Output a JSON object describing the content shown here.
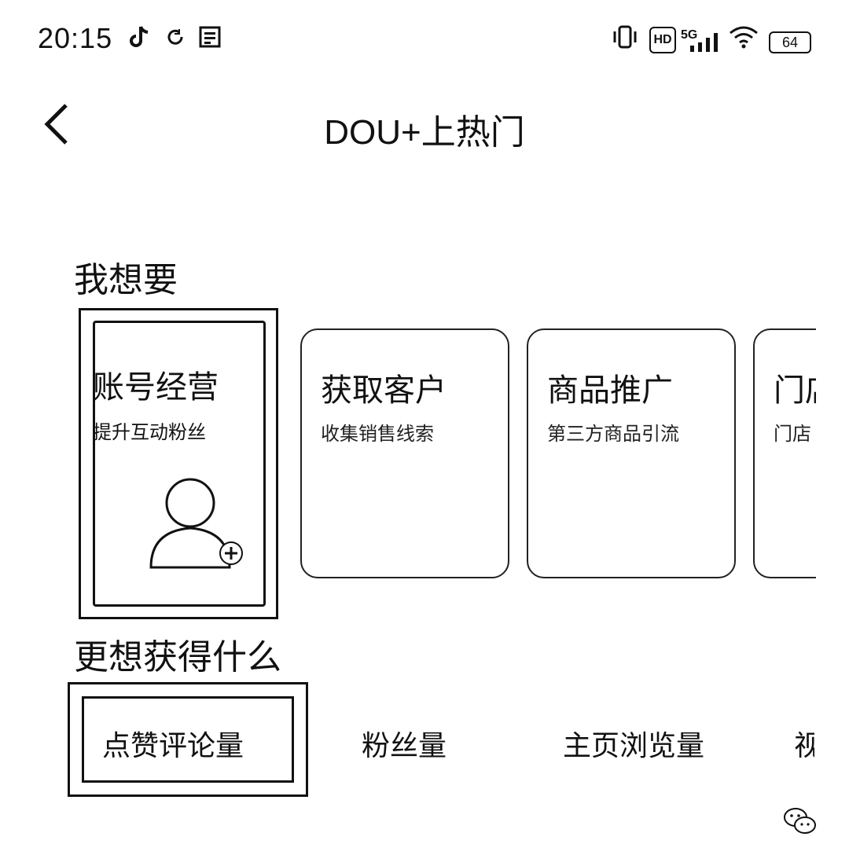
{
  "status_bar": {
    "time": "20:15",
    "left_icons": [
      "tiktok-icon",
      "refresh-icon",
      "app-icon"
    ],
    "right_icons": [
      "vibrate-icon",
      "hd-icon",
      "signal-5g-icon",
      "wifi-icon"
    ],
    "network_label": "5G",
    "hd_label": "HD",
    "battery": "64"
  },
  "header": {
    "back_icon": "chevron-left-icon",
    "title": "DOU+上热门"
  },
  "goal_section": {
    "title": "我想要",
    "cards": [
      {
        "name": "账号经营",
        "desc": "提升互动粉丝",
        "icon": "user-add-icon",
        "selected": true
      },
      {
        "name": "获取客户",
        "desc": "收集销售线索"
      },
      {
        "name": "商品推广",
        "desc": "第三方商品引流"
      },
      {
        "name": "门店",
        "desc": "门店"
      }
    ]
  },
  "metric_section": {
    "title": "更想获得什么",
    "options": [
      {
        "label": "点赞评论量",
        "selected": true
      },
      {
        "label": "粉丝量"
      },
      {
        "label": "主页浏览量"
      },
      {
        "label": "视"
      }
    ]
  }
}
